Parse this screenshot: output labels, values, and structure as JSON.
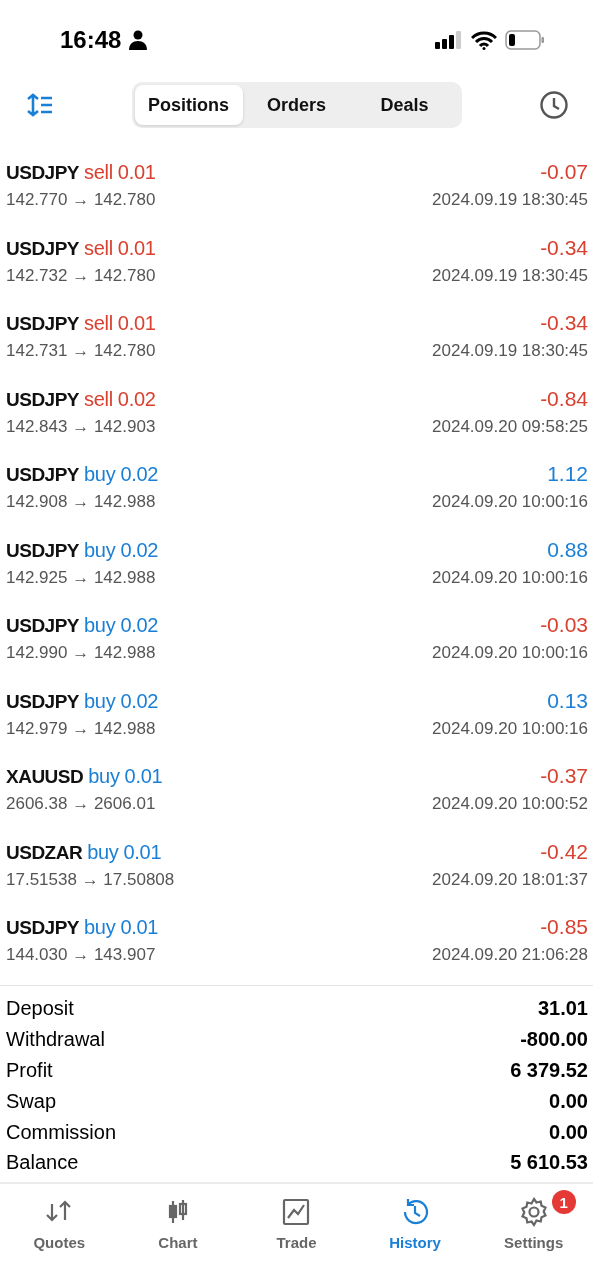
{
  "status_bar": {
    "time": "16:48"
  },
  "tabs": [
    {
      "label": "Positions",
      "selected": true
    },
    {
      "label": "Orders",
      "selected": false
    },
    {
      "label": "Deals",
      "selected": false
    }
  ],
  "deals": [
    {
      "symbol": "USDJPY",
      "side": "sell",
      "volume": "0.01",
      "profit": "-0.07",
      "color": "#d9402f",
      "prices": "142.770 → 142.780",
      "time": "2024.09.19 18:30:45"
    },
    {
      "symbol": "USDJPY",
      "side": "sell",
      "volume": "0.01",
      "profit": "-0.34",
      "color": "#d9402f",
      "prices": "142.732 → 142.780",
      "time": "2024.09.19 18:30:45"
    },
    {
      "symbol": "USDJPY",
      "side": "sell",
      "volume": "0.01",
      "profit": "-0.34",
      "color": "#d9402f",
      "prices": "142.731 → 142.780",
      "time": "2024.09.19 18:30:45"
    },
    {
      "symbol": "USDJPY",
      "side": "sell",
      "volume": "0.02",
      "profit": "-0.84",
      "color": "#d9402f",
      "prices": "142.843 → 142.903",
      "time": "2024.09.20 09:58:25"
    },
    {
      "symbol": "USDJPY",
      "side": "buy",
      "volume": "0.02",
      "profit": "1.12",
      "color": "#1a7fd6",
      "prices": "142.908 → 142.988",
      "time": "2024.09.20 10:00:16"
    },
    {
      "symbol": "USDJPY",
      "side": "buy",
      "volume": "0.02",
      "profit": "0.88",
      "color": "#1a7fd6",
      "prices": "142.925 → 142.988",
      "time": "2024.09.20 10:00:16"
    },
    {
      "symbol": "USDJPY",
      "side": "buy",
      "volume": "0.02",
      "profit": "-0.03",
      "color": "#d9402f",
      "prices": "142.990 → 142.988",
      "time": "2024.09.20 10:00:16"
    },
    {
      "symbol": "USDJPY",
      "side": "buy",
      "volume": "0.02",
      "profit": "0.13",
      "color": "#1a7fd6",
      "prices": "142.979 → 142.988",
      "time": "2024.09.20 10:00:16"
    },
    {
      "symbol": "XAUUSD",
      "side": "buy",
      "volume": "0.01",
      "profit": "-0.37",
      "color": "#d9402f",
      "prices": "2606.38 → 2606.01",
      "time": "2024.09.20 10:00:52"
    },
    {
      "symbol": "USDZAR",
      "side": "buy",
      "volume": "0.01",
      "profit": "-0.42",
      "color": "#d9402f",
      "prices": "17.51538 → 17.50808",
      "time": "2024.09.20 18:01:37"
    },
    {
      "symbol": "USDJPY",
      "side": "buy",
      "volume": "0.01",
      "profit": "-0.85",
      "color": "#d9402f",
      "prices": "144.030 → 143.907",
      "time": "2024.09.20 21:06:28"
    }
  ],
  "summary": [
    {
      "label": "Deposit",
      "value": "31.01"
    },
    {
      "label": "Withdrawal",
      "value": "-800.00"
    },
    {
      "label": "Profit",
      "value": "6 379.52"
    },
    {
      "label": "Swap",
      "value": "0.00"
    },
    {
      "label": "Commission",
      "value": "0.00"
    },
    {
      "label": "Balance",
      "value": "5 610.53"
    }
  ],
  "nav": [
    {
      "kind": "quotes",
      "label": "Quotes",
      "selected": false
    },
    {
      "kind": "chart",
      "label": "Chart",
      "selected": false
    },
    {
      "kind": "trade",
      "label": "Trade",
      "selected": false
    },
    {
      "kind": "history",
      "label": "History",
      "selected": true
    },
    {
      "kind": "settings",
      "label": "Settings",
      "selected": false,
      "badge": "1"
    }
  ]
}
